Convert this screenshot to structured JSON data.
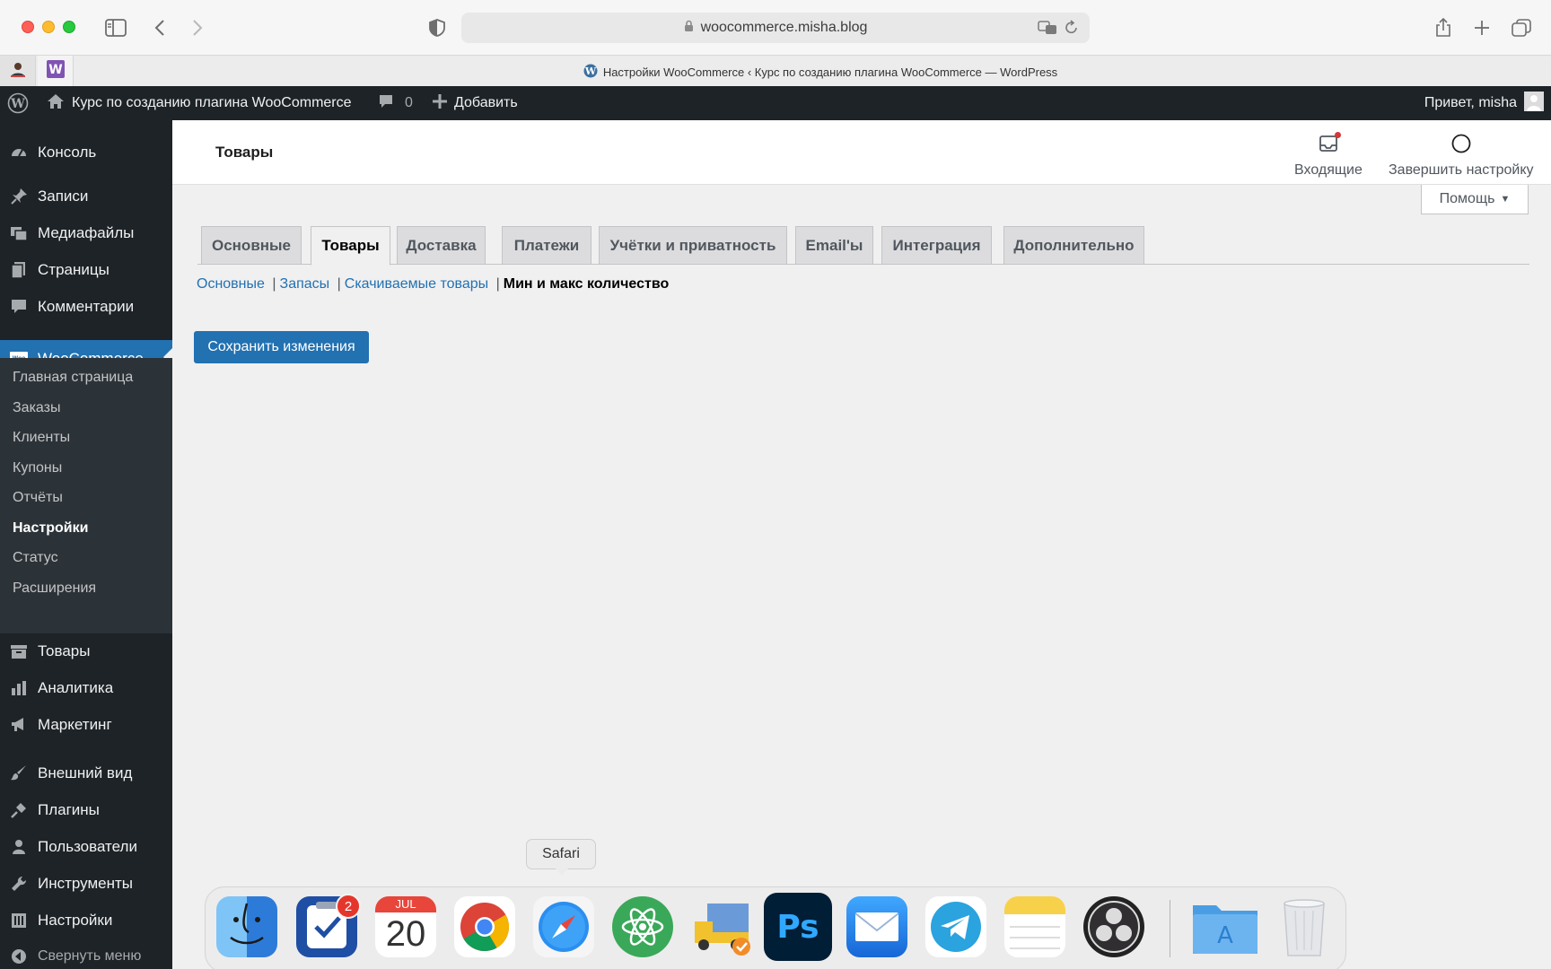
{
  "browser": {
    "url": "woocommerce.misha.blog",
    "tab_title": "Настройки WooCommerce ‹ Курс по созданию плагина WooCommerce — WordPress"
  },
  "adminbar": {
    "site_name": "Курс по созданию плагина WooCommerce",
    "comments_count": "0",
    "new_label": "Добавить",
    "greeting": "Привет, misha"
  },
  "sidebar": {
    "items": [
      {
        "label": "Консоль",
        "icon": "dashboard-icon"
      },
      {
        "label": "Записи",
        "icon": "pin-icon"
      },
      {
        "label": "Медиафайлы",
        "icon": "media-icon"
      },
      {
        "label": "Страницы",
        "icon": "page-icon"
      },
      {
        "label": "Комментарии",
        "icon": "comment-icon"
      },
      {
        "label": "WooCommerce",
        "icon": "woo-icon"
      },
      {
        "label": "Товары",
        "icon": "archive-icon"
      },
      {
        "label": "Аналитика",
        "icon": "chart-icon"
      },
      {
        "label": "Маркетинг",
        "icon": "megaphone-icon"
      },
      {
        "label": "Внешний вид",
        "icon": "brush-icon"
      },
      {
        "label": "Плагины",
        "icon": "plugin-icon"
      },
      {
        "label": "Пользователи",
        "icon": "user-icon"
      },
      {
        "label": "Инструменты",
        "icon": "wrench-icon"
      },
      {
        "label": "Настройки",
        "icon": "settings-icon"
      },
      {
        "label": "Свернуть меню",
        "icon": "collapse-icon"
      }
    ],
    "submenu": [
      "Главная страница",
      "Заказы",
      "Клиенты",
      "Купоны",
      "Отчёты",
      "Настройки",
      "Статус",
      "Расширения"
    ]
  },
  "woo_header": {
    "title": "Товары",
    "inbox_label": "Входящие",
    "finish_setup_label": "Завершить настройку"
  },
  "help_label": "Помощь",
  "tabs": [
    "Основные",
    "Товары",
    "Доставка",
    "Платежи",
    "Учётки и приватность",
    "Email'ы",
    "Интеграция",
    "Дополнительно"
  ],
  "active_tab": "Товары",
  "subsections": [
    "Основные",
    "Запасы",
    "Скачиваемые товары",
    "Мин и макс количество"
  ],
  "save_label": "Сохранить изменения",
  "dock": {
    "tooltip": "Safari",
    "tasks_badge": "2",
    "calendar_month": "JUL",
    "calendar_day": "20"
  }
}
